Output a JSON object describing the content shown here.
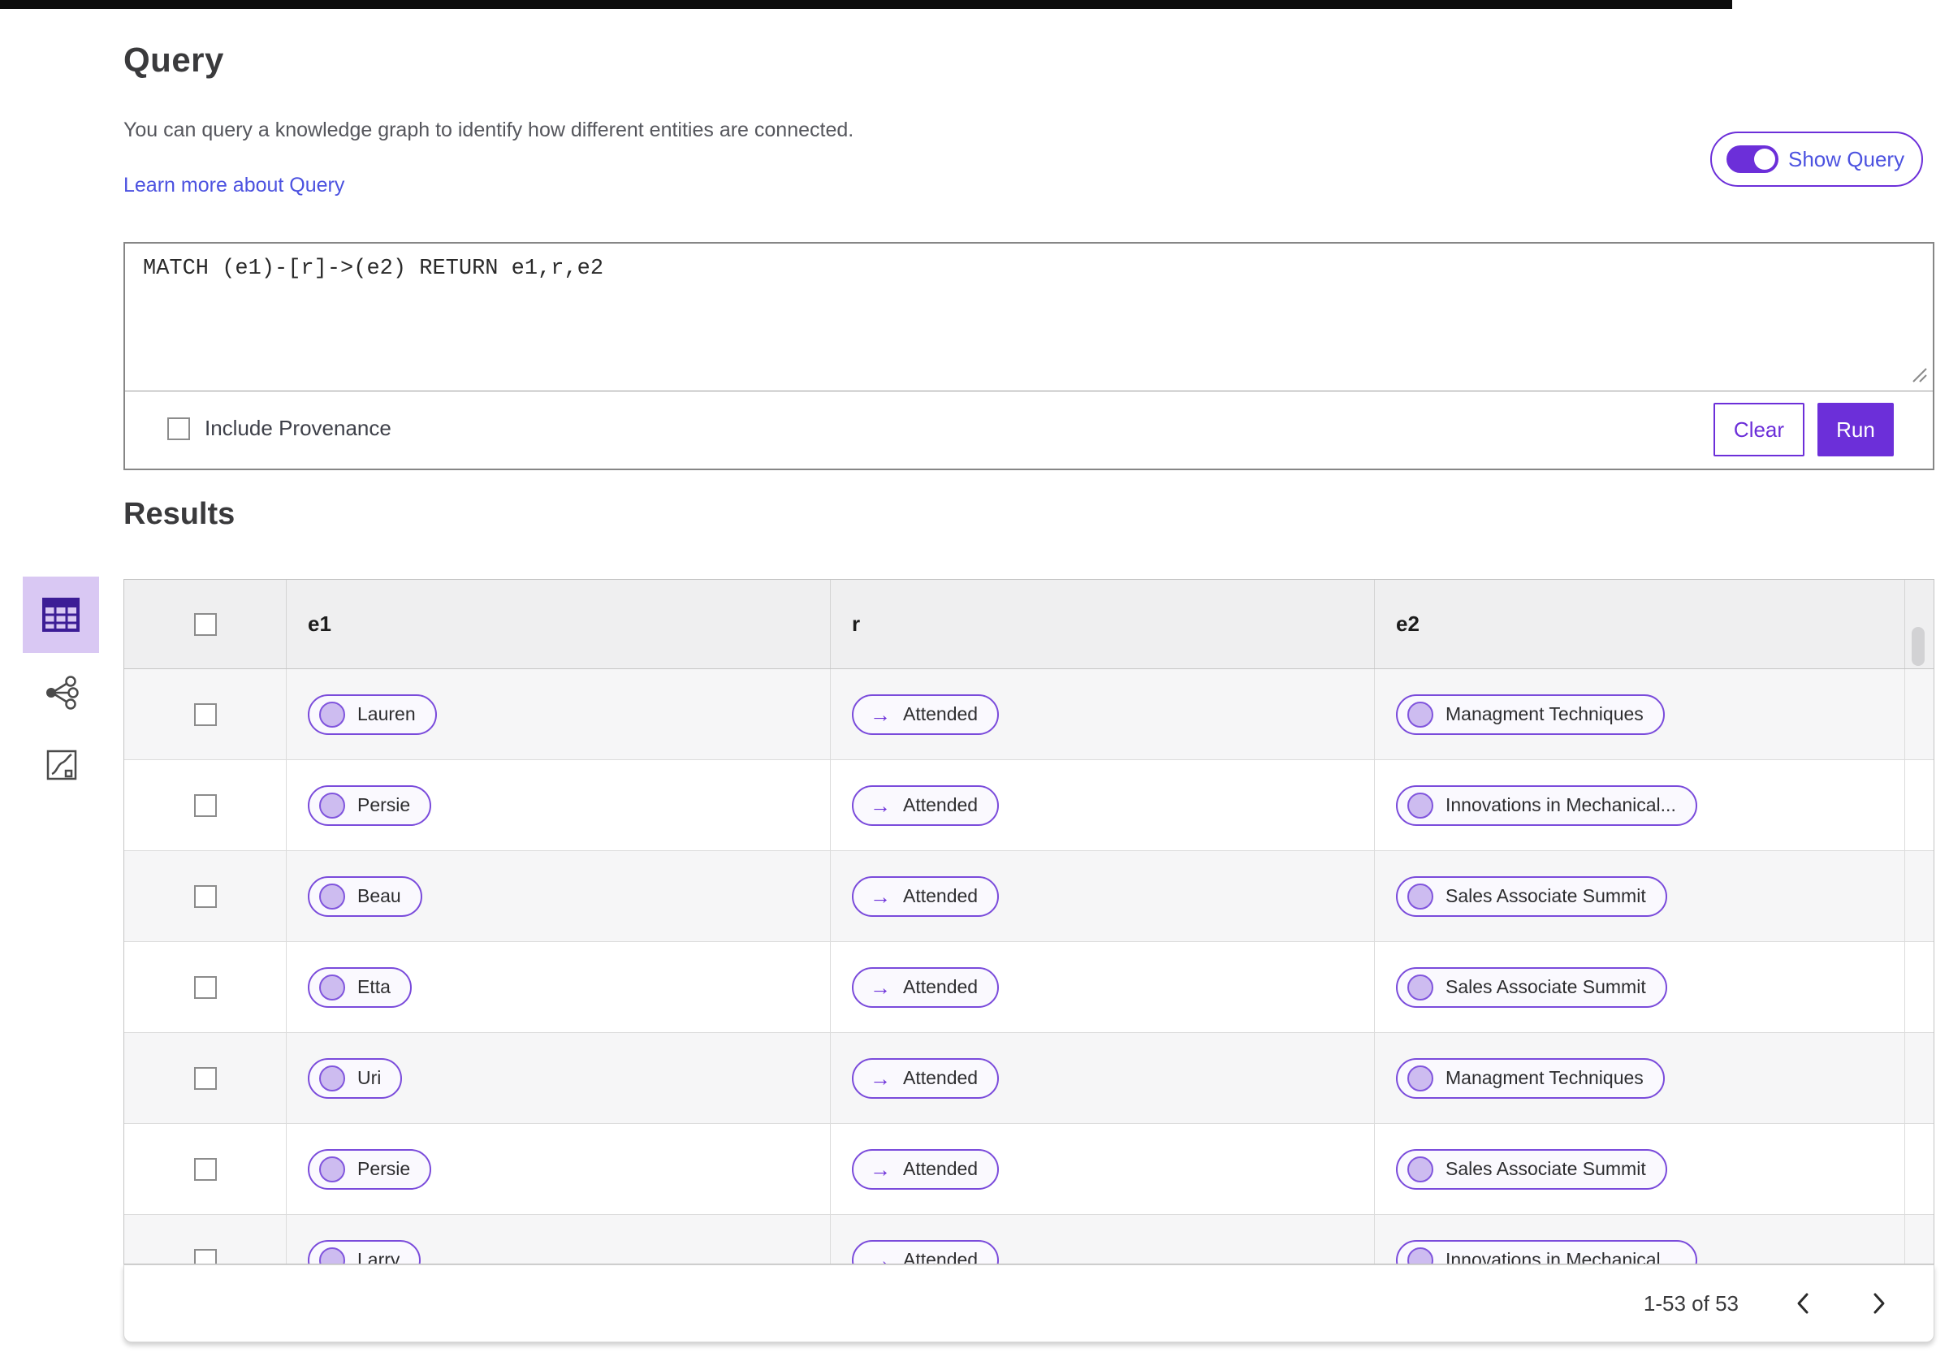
{
  "header": {
    "title": "Query",
    "description": "You can query a knowledge graph to identify how different entities are connected.",
    "learn_more_link": "Learn more about Query",
    "show_query_label": "Show Query",
    "show_query_on": true
  },
  "query_panel": {
    "query_text": "MATCH (e1)-[r]->(e2) RETURN e1,r,e2",
    "include_provenance_label": "Include Provenance",
    "include_provenance_checked": false,
    "clear_label": "Clear",
    "run_label": "Run"
  },
  "results": {
    "title": "Results",
    "view_switcher": {
      "selected": "table-view",
      "icons": [
        "table-view-icon",
        "graph-view-icon",
        "chart-view-icon"
      ]
    },
    "columns": {
      "c1": "e1",
      "c2": "r",
      "c3": "e2"
    },
    "rows": [
      {
        "e1": "Lauren",
        "r": "Attended",
        "e2": "Managment Techniques"
      },
      {
        "e1": "Persie",
        "r": "Attended",
        "e2": "Innovations in Mechanical..."
      },
      {
        "e1": "Beau",
        "r": "Attended",
        "e2": "Sales Associate Summit"
      },
      {
        "e1": "Etta",
        "r": "Attended",
        "e2": "Sales Associate Summit"
      },
      {
        "e1": "Uri",
        "r": "Attended",
        "e2": "Managment Techniques"
      },
      {
        "e1": "Persie",
        "r": "Attended",
        "e2": "Sales Associate Summit"
      },
      {
        "e1": "Larry",
        "r": "Attended",
        "e2": "Innovations in Mechanical..."
      }
    ],
    "pagination": {
      "label": "1-53 of 53",
      "prev_icon": "chevron-left-icon",
      "next_icon": "chevron-right-icon"
    }
  },
  "colors": {
    "accent_purple": "#6c2fd9",
    "pill_border": "#7a4bdb",
    "pill_background": "#faf9fe",
    "pill_circle": "#cdbcf0",
    "link": "#4c52e0",
    "selected_view_background": "#d9c8f3",
    "header_row_background": "#efeff0",
    "striped_row_background": "#f6f6f7"
  }
}
